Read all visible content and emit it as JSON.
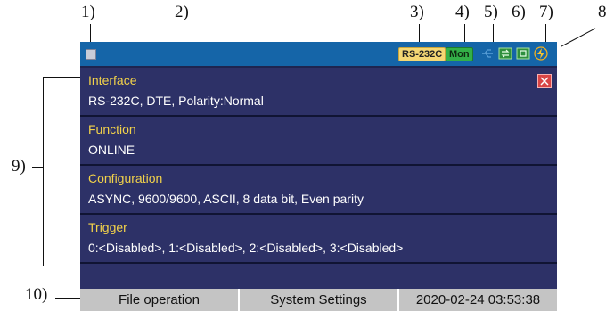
{
  "callouts": {
    "n1": "1)",
    "n2": "2)",
    "n3": "3)",
    "n4": "4)",
    "n5": "5)",
    "n6": "6)",
    "n7": "7)",
    "n8": "8",
    "n9": "9)",
    "n10": "10)"
  },
  "statusbar": {
    "port_badge": "RS-232C",
    "mode_badge": "Mon",
    "icons": [
      "usb-icon",
      "network-icon",
      "storage-icon",
      "power-icon"
    ]
  },
  "sections": [
    {
      "title": "Interface",
      "value": "RS-232C, DTE, Polarity:Normal"
    },
    {
      "title": "Function",
      "value": "ONLINE"
    },
    {
      "title": "Configuration",
      "value": "ASYNC, 9600/9600, ASCII, 8 data bit, Even parity"
    },
    {
      "title": "Trigger",
      "value": "0:<Disabled>, 1:<Disabled>, 2:<Disabled>, 3:<Disabled>"
    }
  ],
  "bottom_bar": {
    "file_operation": "File operation",
    "system_settings": "System Settings",
    "datetime": "2020-02-24 03:53:38"
  },
  "colors": {
    "screen_bg": "#1e2450",
    "statusbar_bg": "#1565a8",
    "section_bg": "#2d3167",
    "title_text": "#f2d24a",
    "badge_mon": "#33b048",
    "badge_rs": "#f4d774"
  }
}
